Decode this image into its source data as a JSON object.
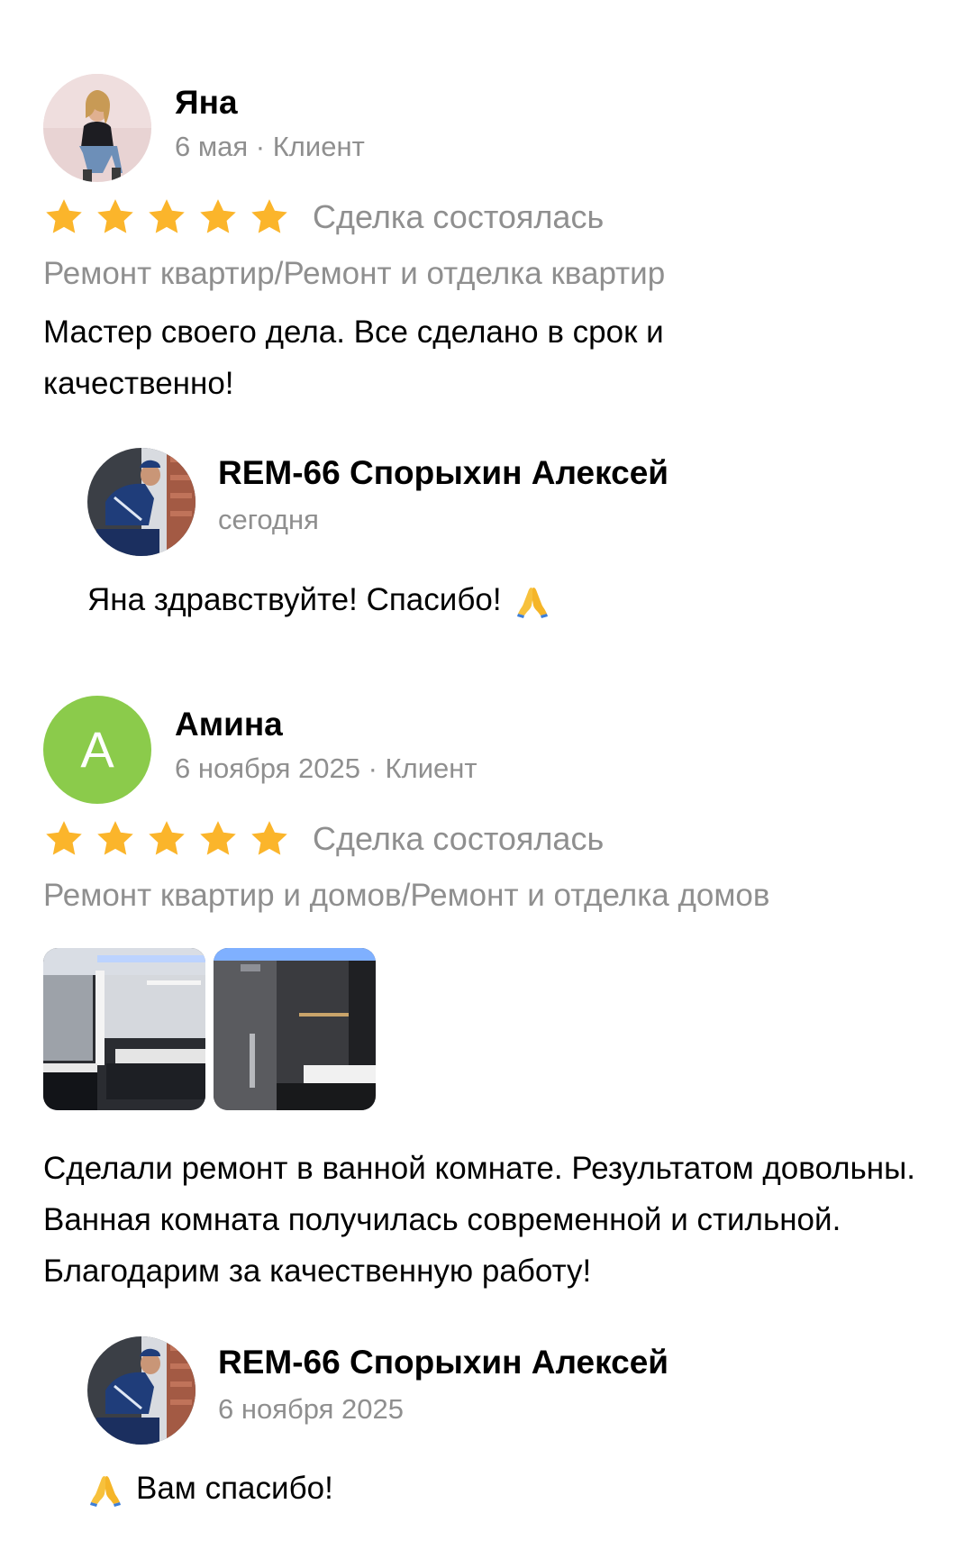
{
  "colors": {
    "star": "#fbb52b",
    "muted_text": "#8f8f8f",
    "letter_avatar_bg": "#8bcb4b"
  },
  "reviews": [
    {
      "author": "Яна",
      "meta": "6 мая · Клиент",
      "avatar_icon": "user-photo",
      "rating": 5,
      "deal_status": "Сделка состоялась",
      "category": "Ремонт квартир/Ремонт и отделка квартир",
      "text": "Мастер своего дела. Все сделано в срок и качественно!",
      "reply": {
        "author": "REM-66 Спорыхин Алексей",
        "date": "сегодня",
        "text": "Яна здравствуйте! Спасибо!",
        "emoji": "folded-hands-icon"
      }
    },
    {
      "author": "Амина",
      "meta": "6 ноября 2025 · Клиент",
      "avatar_letter": "А",
      "rating": 5,
      "deal_status": "Сделка состоялась",
      "category": "Ремонт квартир и домов/Ремонт и отделка домов",
      "photos": [
        "bathroom-photo-1",
        "bathroom-photo-2"
      ],
      "text": "Сделали ремонт в ванной комнате. Результатом довольны. Ванная комната получилась современной и стильной. Благодарим за качественную работу!",
      "reply": {
        "author": "REM-66 Спорыхин Алексей",
        "date": "6 ноября 2025",
        "text": "Вам спасибо!",
        "emoji": "folded-hands-icon"
      }
    }
  ]
}
